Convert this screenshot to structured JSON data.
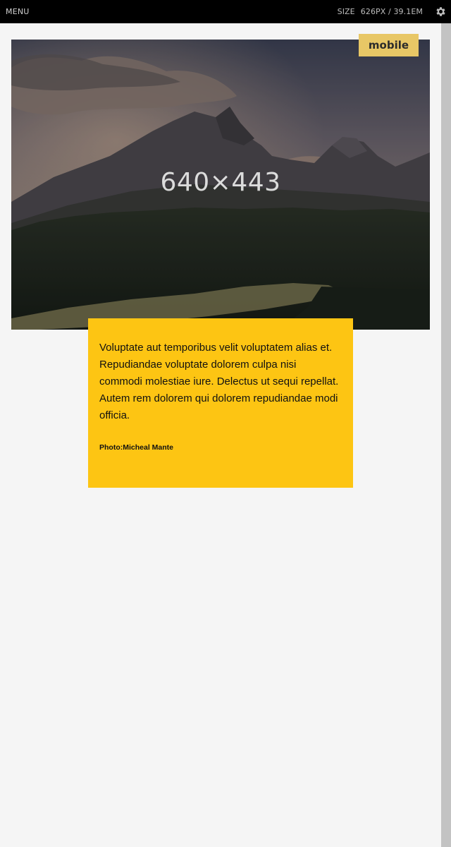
{
  "topbar": {
    "menu_label": "MENU",
    "size_label": "SIZE",
    "size_px": "626PX",
    "size_separator": "/",
    "size_em": "39.1EM",
    "settings_icon": "gear-icon"
  },
  "breakpoint_badge": "mobile",
  "hero": {
    "placeholder_label": "640×443"
  },
  "caption": {
    "text": "Voluptate aut temporibus velit voluptatem alias et. Repudiandae voluptate dolorem culpa nisi commodi molestiae iure. Delectus ut sequi repellat. Autem rem dolorem qui dolorem repudiandae modi officia.",
    "credit": "Photo:Micheal Mante"
  },
  "colors": {
    "topbar_bg": "#000000",
    "page_bg": "#f5f5f5",
    "caption_bg": "#fdc513",
    "badge_bg": "#e8c766"
  }
}
